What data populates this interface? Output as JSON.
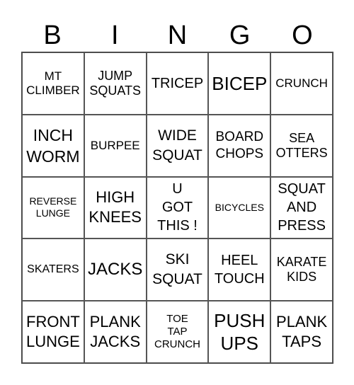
{
  "header": [
    "B",
    "I",
    "N",
    "G",
    "O"
  ],
  "cells": [
    "MT\nCLIMBER",
    "JUMP\nSQUATS",
    "TRICEP",
    "BICEP",
    "CRUNCH",
    "INCH\nWORM",
    "BURPEE",
    "WIDE\nSQUAT",
    "BOARD\nCHOPS",
    "SEA\nOTTERS",
    "REVERSE\nLUNGE",
    "HIGH\nKNEES",
    "U\nGOT\nTHIS !",
    "BICYCLES",
    "SQUAT\nAND\nPRESS",
    "SKATERS",
    "JACKS",
    "SKI\nSQUAT",
    "HEEL\nTOUCH",
    "KARATE\nKIDS",
    "FRONT\nLUNGE",
    "PLANK\nJACKS",
    "TOE\nTAP\nCRUNCH",
    "PUSH\nUPS",
    "PLANK\nTAPS"
  ]
}
